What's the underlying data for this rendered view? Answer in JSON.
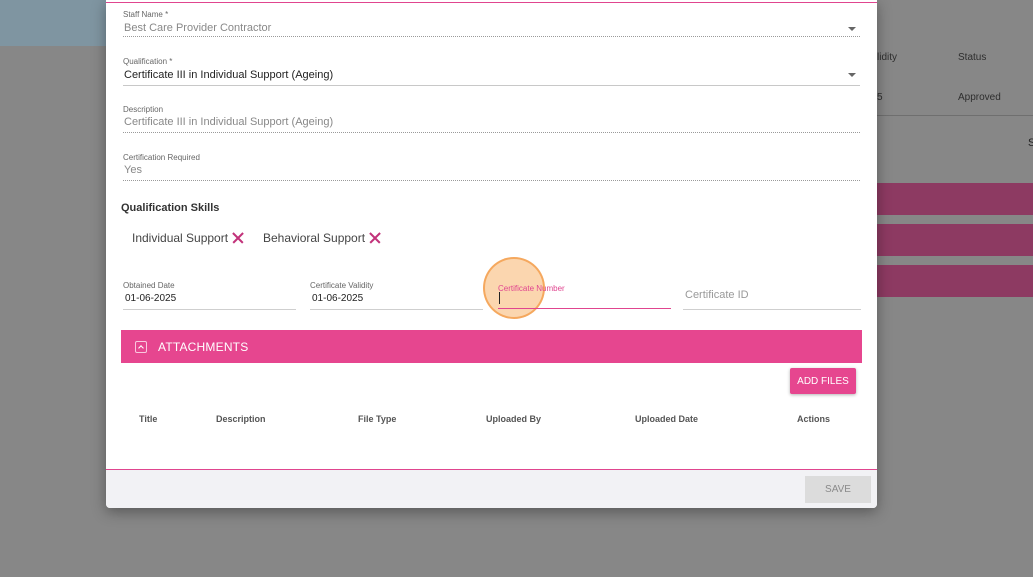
{
  "background": {
    "headers": {
      "validity": "lidity",
      "status": "Status"
    },
    "row": {
      "validity_fragment": "5",
      "status": "Approved"
    },
    "side_letter": "S"
  },
  "form": {
    "staff_name": {
      "label": "Staff Name *",
      "value": "Best Care Provider Contractor"
    },
    "qualification": {
      "label": "Qualification *",
      "value": "Certificate III in Individual Support (Ageing)"
    },
    "description": {
      "label": "Description",
      "value": "Certificate III in Individual Support (Ageing)"
    },
    "certification_required": {
      "label": "Certification Required",
      "value": "Yes"
    },
    "skills_title": "Qualification Skills",
    "skills": [
      {
        "label": "Individual Support"
      },
      {
        "label": "Behavioral Support"
      }
    ],
    "obtained_date": {
      "label": "Obtained Date",
      "value": "01-06-2025"
    },
    "certificate_validity": {
      "label": "Certificate Validity",
      "value": "01-06-2025"
    },
    "certificate_number": {
      "label": "Certificate Number",
      "value": ""
    },
    "certificate_id": {
      "placeholder": "Certificate ID"
    }
  },
  "attachments": {
    "title": "ATTACHMENTS",
    "add_files_label": "ADD FILES",
    "columns": [
      "Title",
      "Description",
      "File Type",
      "Uploaded By",
      "Uploaded Date",
      "Actions"
    ]
  },
  "footer": {
    "save_label": "SAVE"
  },
  "colors": {
    "accent": "#e6468f",
    "overlay": "#878787"
  }
}
